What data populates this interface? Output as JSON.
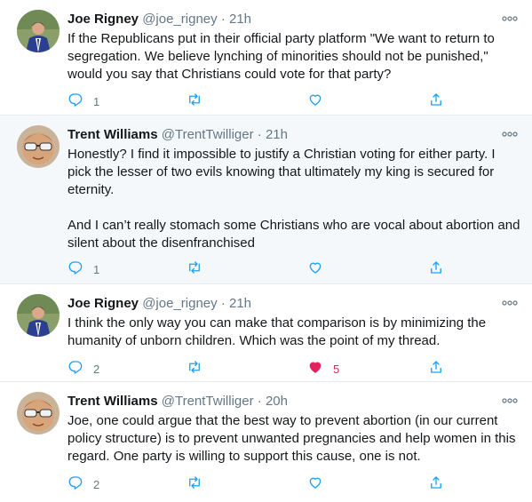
{
  "colors": {
    "accent": "#1da1f2",
    "like": "#e0245e",
    "secondary": "#657786",
    "highlight_bg": "#f5f8fa"
  },
  "tweets": [
    {
      "name": "Joe Rigney",
      "handle": "@joe_rigney",
      "dot": "·",
      "time": "21h",
      "paragraphs": [
        "If the Republicans put in their official party platform \"We want to return to segregation. We believe lynching of minorities should not be punished,\" would you say that Christians could vote for that party?"
      ],
      "reply_count": "1",
      "retweet_count": "",
      "like_count": "",
      "liked": false
    },
    {
      "name": "Trent Williams",
      "handle": "@TrentTwilliger",
      "dot": "·",
      "time": "21h",
      "paragraphs": [
        "Honestly? I find it impossible to justify a Christian voting for either party. I pick the lesser of two evils knowing that ultimately my king is secured for eternity.",
        "And I can’t really stomach some Christians who are vocal about abortion and silent about the disenfranchised"
      ],
      "reply_count": "1",
      "retweet_count": "",
      "like_count": "",
      "liked": false
    },
    {
      "name": "Joe Rigney",
      "handle": "@joe_rigney",
      "dot": "·",
      "time": "21h",
      "paragraphs": [
        "I think the only way you can make that comparison is by minimizing the humanity of unborn children. Which was the point of my thread."
      ],
      "reply_count": "2",
      "retweet_count": "",
      "like_count": "5",
      "liked": true
    },
    {
      "name": "Trent Williams",
      "handle": "@TrentTwilliger",
      "dot": "·",
      "time": "20h",
      "paragraphs": [
        "Joe, one could argue that the best way to prevent abortion (in our current policy structure) is to prevent unwanted pregnancies and help women in this regard. One party is willing to support this cause, one is not."
      ],
      "reply_count": "2",
      "retweet_count": "",
      "like_count": "",
      "liked": false
    }
  ]
}
